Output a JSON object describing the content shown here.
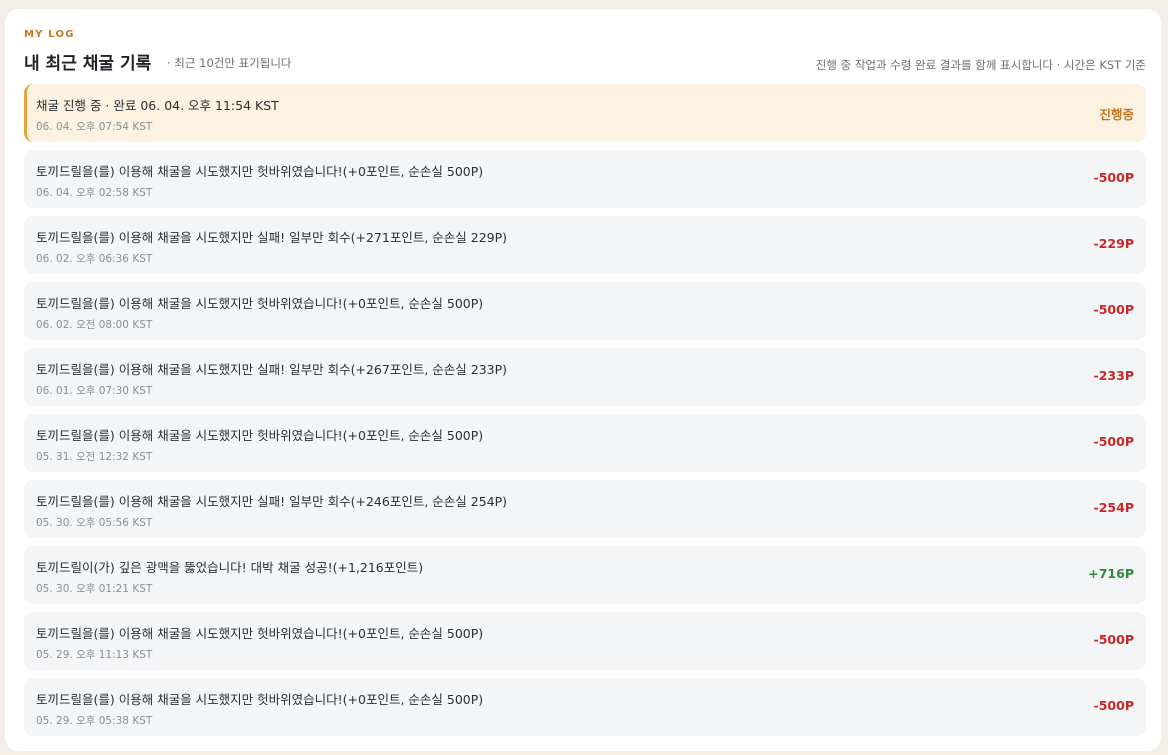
{
  "header": {
    "eyebrow": "MY LOG",
    "title": "내 최근 채굴 기록",
    "subtitle": "· 최근 10건만 표기됩니다",
    "note": "진행 중 작업과 수령 완료 결과를 함께 표시합니다 · 시간은 KST 기준"
  },
  "records": [
    {
      "title": "채굴 진행 중 · 완료 06. 04. 오후 11:54 KST",
      "time": "06. 04. 오후 07:54 KST",
      "amount": "진행중",
      "kind": "pending"
    },
    {
      "title": "토끼드릴을(를) 이용해 채굴을 시도했지만 헛바위였습니다!(+0포인트, 순손실 500P)",
      "time": "06. 04. 오후 02:58 KST",
      "amount": "-500P",
      "kind": "loss"
    },
    {
      "title": "토끼드릴을(를) 이용해 채굴을 시도했지만 실패! 일부만 회수(+271포인트, 순손실 229P)",
      "time": "06. 02. 오후 06:36 KST",
      "amount": "-229P",
      "kind": "loss"
    },
    {
      "title": "토끼드릴을(를) 이용해 채굴을 시도했지만 헛바위였습니다!(+0포인트, 순손실 500P)",
      "time": "06. 02. 오전 08:00 KST",
      "amount": "-500P",
      "kind": "loss"
    },
    {
      "title": "토끼드릴을(를) 이용해 채굴을 시도했지만 실패! 일부만 회수(+267포인트, 순손실 233P)",
      "time": "06. 01. 오후 07:30 KST",
      "amount": "-233P",
      "kind": "loss"
    },
    {
      "title": "토끼드릴을(를) 이용해 채굴을 시도했지만 헛바위였습니다!(+0포인트, 순손실 500P)",
      "time": "05. 31. 오전 12:32 KST",
      "amount": "-500P",
      "kind": "loss"
    },
    {
      "title": "토끼드릴을(를) 이용해 채굴을 시도했지만 실패! 일부만 회수(+246포인트, 순손실 254P)",
      "time": "05. 30. 오후 05:56 KST",
      "amount": "-254P",
      "kind": "loss"
    },
    {
      "title": "토끼드릴이(가) 깊은 광맥을 뚫었습니다! 대박 채굴 성공!(+1,216포인트)",
      "time": "05. 30. 오후 01:21 KST",
      "amount": "+716P",
      "kind": "gain"
    },
    {
      "title": "토끼드릴을(를) 이용해 채굴을 시도했지만 헛바위였습니다!(+0포인트, 순손실 500P)",
      "time": "05. 29. 오후 11:13 KST",
      "amount": "-500P",
      "kind": "loss"
    },
    {
      "title": "토끼드릴을(를) 이용해 채굴을 시도했지만 헛바위였습니다!(+0포인트, 순손실 500P)",
      "time": "05. 29. 오후 05:38 KST",
      "amount": "-500P",
      "kind": "loss"
    }
  ],
  "colors": {
    "accent": "#c47a22",
    "loss": "#c62828",
    "gain": "#2e8b3a",
    "pending_bg": "#fdf2e1"
  }
}
